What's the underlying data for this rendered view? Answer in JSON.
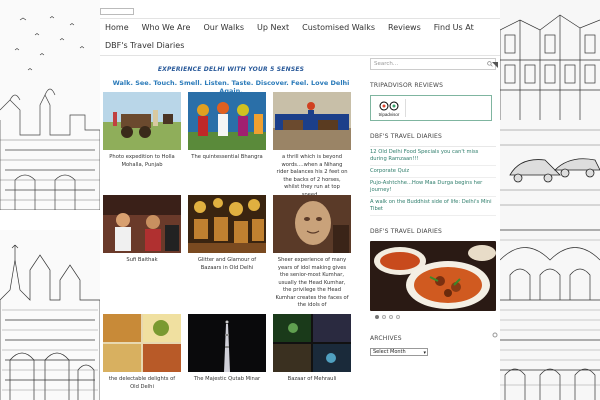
{
  "nav": {
    "items": [
      {
        "label": "Home"
      },
      {
        "label": "Who We Are"
      },
      {
        "label": "Our Walks"
      },
      {
        "label": "Up Next"
      },
      {
        "label": "Customised Walks"
      },
      {
        "label": "Reviews"
      },
      {
        "label": "Find Us At"
      },
      {
        "label": "DBF's Travel Diaries"
      }
    ]
  },
  "hero": {
    "tagline": "EXPERIENCE DELHI WITH YOUR 5 SENSES",
    "slogan": "Walk. See. Touch. Smell. Listen. Taste. Discover. Feel. Love Delhi Again."
  },
  "gallery": [
    {
      "caption": "Photo expedition to Holla Mohalla, Punjab"
    },
    {
      "caption": "The quintessential Bhangra"
    },
    {
      "caption": "a thrill which is beyond words....when a Nihang rider balances his 2 feet on the backs of 2 horses, whilst they run at top speed..."
    },
    {
      "caption": "Sufi Baithak"
    },
    {
      "caption": "Glitter and Glamour of Bazaars in Old Delhi"
    },
    {
      "caption": "Sheer experience of many years of idol making gives the senior-most Kumhar, usually the Head Kumhar, the privilege the Head Kumhar creates the faces of the idols of"
    },
    {
      "caption": "the delectable delights of Old Delhi"
    },
    {
      "caption": "The Majestic Qutab Minar"
    },
    {
      "caption": "Bazaar of Mehrauli"
    }
  ],
  "sidebar": {
    "search_placeholder": "Search...",
    "tripadvisor_title": "TRIPADVISOR REVIEWS",
    "tripadvisor_logo_text": "tripadvisor",
    "diaries_title_1": "DBF'S TRAVEL DIARIES",
    "diaries_links": [
      {
        "label": "12 Old Delhi Food Specials you can't miss during Ramzaan!!!"
      },
      {
        "label": "Corporate Quiz"
      },
      {
        "label": "Pujo-Ashtchhe...How Maa Durga begins her journey!"
      },
      {
        "label": "A walk on the Buddhist side of life: Delhi's Mini Tibet"
      }
    ],
    "diaries_title_2": "DBF'S TRAVEL DIARIES",
    "archives_title": "ARCHIVES",
    "archives_select": "Select Month"
  },
  "colors": {
    "accent_blue": "#2a7ab9",
    "link_green": "#2e7d6b",
    "trip_border": "#7fb5a0"
  }
}
